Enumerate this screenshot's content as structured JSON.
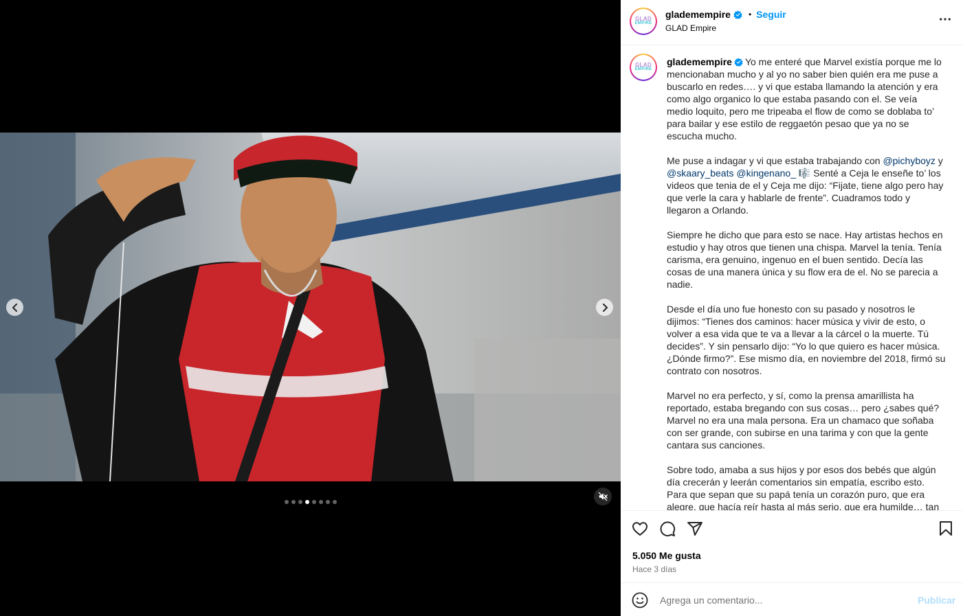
{
  "post": {
    "username": "glademempire",
    "follow_label": "Seguir",
    "separator": "•",
    "subtitle": "GLAD Empire",
    "logo_top": "GLAD",
    "logo_bottom": "EMPIRE"
  },
  "caption": {
    "username": "glademempire",
    "p1": "Yo me enteré que Marvel existía porque me lo mencionaban mucho y al yo no saber bien quién era me puse a buscarlo en redes…. y vi que estaba llamando la atención y era como algo organico lo que estaba pasando con el. Se veía medio loquito, pero me tripeaba el flow de como se doblaba to’ para bailar y ese estilo de reggaetón pesao que ya no se escucha mucho.",
    "p2_a": "Me puse a indagar y vi que estaba trabajando con ",
    "p2_m1": "@pichyboyz",
    "p2_b": " y ",
    "p2_m2": "@skaary_beats",
    "p2_c": " ",
    "p2_m3": "@kingenano_",
    "p2_d": " 🎼 Senté a Ceja le enseñe to’ los videos que tenia de el y Ceja me dijo: “Fijate, tiene algo pero hay que verle la cara y hablarle de frente”. Cuadramos todo y llegaron a Orlando.",
    "p3": "Siempre he dicho que para esto se nace. Hay artistas hechos en estudio y hay otros que tienen una chispa. Marvel la tenía. Tenía carisma, era genuino, ingenuo en el buen sentido. Decía las cosas de una manera única y su flow era de el. No se parecia a nadie.",
    "p4": "Desde el día uno fue honesto con su pasado y nosotros le dijimos: “Tienes dos caminos: hacer música y vivir de esto, o volver a esa vida que te va a llevar a la cárcel o la muerte. Tú decides”. Y sin pensarlo dijo: “Yo lo que quiero es hacer música. ¿Dónde firmo?”. Ese mismo día, en noviembre del 2018, firmó su contrato con nosotros.",
    "p5": "Marvel no era perfecto, y sí, como la prensa amarillista ha reportado, estaba bregando con sus cosas… pero ¿sabes qué? Marvel no era una mala persona. Era un chamaco que soñaba con ser grande, con subirse en una tarima y con que la gente cantara sus canciones.",
    "p6": "Sobre todo, amaba a sus hijos y por esos dos bebés que algún día crecerán y leerán comentarios sin empatía, escribo esto. Para que sepan que su papá tenía un corazón puro, que era alegre, que hacía reír hasta al más serio, que era humilde… tan humilde que no se daba cuenta de lo grande que era. Marvel podía ser"
  },
  "stats": {
    "likes": "5.050 Me gusta",
    "date": "Hace 3 días"
  },
  "comment": {
    "placeholder": "Agrega un comentario...",
    "publish_label": "Publicar"
  },
  "carousel": {
    "slides": 8,
    "active_index": 3
  },
  "colors": {
    "accent": "#0095f6",
    "mention": "#00376b",
    "publish_disabled": "#b2dffc",
    "secondary_text": "#737373"
  },
  "icons": [
    "chevron-left-icon",
    "chevron-right-icon",
    "muted-speaker-icon",
    "verified-badge-icon",
    "more-options-icon",
    "heart-icon",
    "comment-icon",
    "share-icon",
    "bookmark-icon",
    "emoji-icon"
  ]
}
